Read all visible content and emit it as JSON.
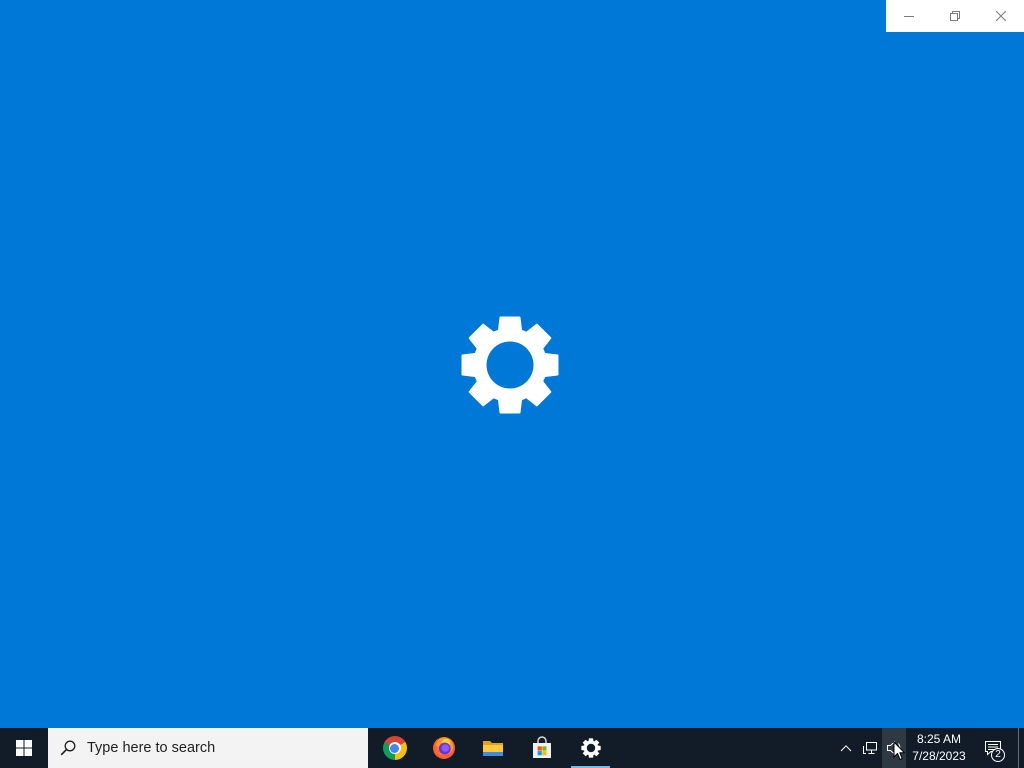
{
  "colors": {
    "accent": "#0078d7",
    "taskbar": "#111c28",
    "active_indicator": "#76b9ed",
    "caption_bar": "#ffffff",
    "caption_icon": "#7a7a7a",
    "search_box": "#f3f3f3"
  },
  "window": {
    "caption_buttons": [
      {
        "icon": "minimize-icon"
      },
      {
        "icon": "restore-icon"
      },
      {
        "icon": "close-icon"
      }
    ],
    "splash_icon": "gear-icon"
  },
  "taskbar": {
    "start_icon": "windows-logo-icon",
    "search": {
      "icon": "search-icon",
      "placeholder": "Type here to search"
    },
    "pinned_apps": [
      {
        "icon": "chrome-icon",
        "active": false
      },
      {
        "icon": "firefox-icon",
        "active": false
      },
      {
        "icon": "file-explorer-icon",
        "active": false
      },
      {
        "icon": "microsoft-store-icon",
        "active": false
      },
      {
        "icon": "settings-icon",
        "active": true
      }
    ],
    "tray": {
      "icons": [
        "chevron-up-icon",
        "network-icon",
        "volume-icon"
      ],
      "hovered": "volume-icon",
      "time": "8:25 AM",
      "date": "7/28/2023",
      "notification_icon": "action-center-icon",
      "notification_count": "2"
    }
  }
}
